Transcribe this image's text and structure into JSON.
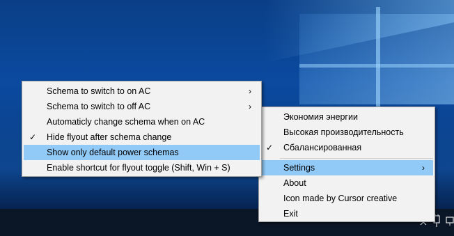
{
  "colors": {
    "menu_background": "#f2f2f2",
    "menu_highlight": "#91c9f7",
    "desktop_blue": "#0b4aa0",
    "taskbar": "#0b1626"
  },
  "left_menu": {
    "items": [
      {
        "label": "Schema to switch to on AC",
        "checked": false,
        "submenu": true,
        "highlighted": false
      },
      {
        "label": "Schema to switch to off AC",
        "checked": false,
        "submenu": true,
        "highlighted": false
      },
      {
        "label": "Automaticly change schema when on AC",
        "checked": false,
        "submenu": false,
        "highlighted": false
      },
      {
        "label": "Hide flyout after schema change",
        "checked": true,
        "submenu": false,
        "highlighted": false
      },
      {
        "label": "Show only default power schemas",
        "checked": false,
        "submenu": false,
        "highlighted": true
      },
      {
        "label": "Enable shortcut for flyout toggle (Shift, Win + S)",
        "checked": false,
        "submenu": false,
        "highlighted": false
      }
    ]
  },
  "right_menu": {
    "schemas": [
      {
        "label": "Экономия энергии",
        "checked": false
      },
      {
        "label": "Высокая производительность",
        "checked": false
      },
      {
        "label": "Сбалансированная",
        "checked": true
      }
    ],
    "settings_label": "Settings",
    "about_label": "About",
    "credit_label": "Icon made by Cursor creative",
    "exit_label": "Exit"
  },
  "glyphs": {
    "check": "✓",
    "submenu_arrow": "›"
  },
  "tray": {
    "icons": [
      "chevron-up-icon",
      "power-plug-icon",
      "network-icon"
    ]
  }
}
